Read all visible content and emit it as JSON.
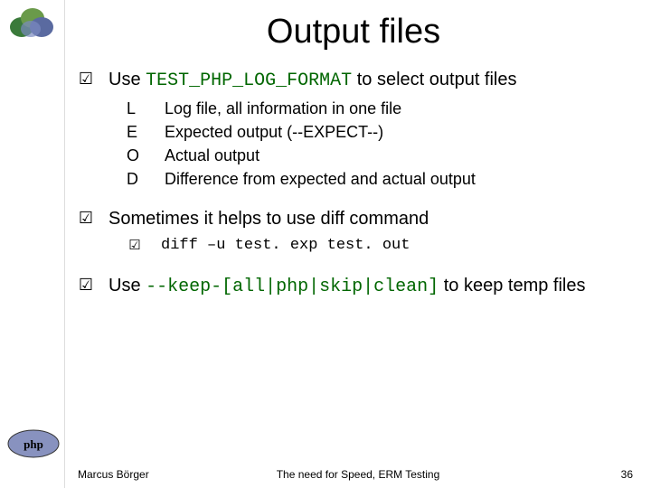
{
  "title": "Output files",
  "bullets": [
    {
      "pre": "Use ",
      "code": "TEST_PHP_LOG_FORMAT",
      "post": " to select output files",
      "subtype": "keys",
      "subs": [
        {
          "k": "L",
          "v": "Log file, all information in one file"
        },
        {
          "k": "E",
          "v": "Expected output (--EXPECT--)"
        },
        {
          "k": "O",
          "v": "Actual output"
        },
        {
          "k": "D",
          "v": "Difference from expected and actual output"
        }
      ]
    },
    {
      "pre": "Sometimes it helps to use diff command",
      "code": "",
      "post": "",
      "subtype": "check",
      "subs": [
        {
          "v": "diff –u test. exp test. out"
        }
      ]
    },
    {
      "pre": "Use ",
      "code": "--keep-[all|php|skip|clean]",
      "post": " to keep temp files",
      "subtype": "none",
      "subs": []
    }
  ],
  "footer": {
    "left": "Marcus Börger",
    "center": "The need for Speed, ERM Testing",
    "right": "36"
  }
}
